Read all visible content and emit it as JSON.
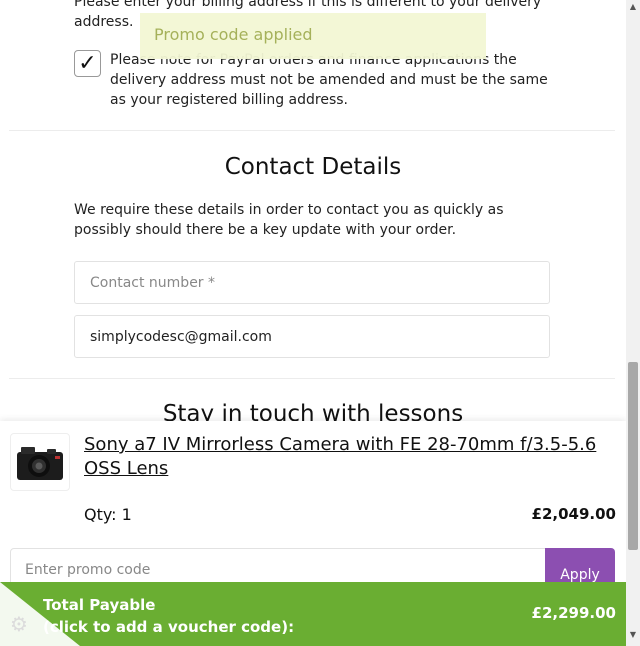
{
  "billing": {
    "note": "Please enter your billing address if this is different to your delivery address.",
    "checkbox_checked": true,
    "checkbox_mark": "✓",
    "paypal_note": "Please note for PayPal orders and finance applications the delivery address must not be amended and must be the same as your registered billing address."
  },
  "toast": {
    "message": "Promo code applied"
  },
  "contact": {
    "title": "Contact Details",
    "description": "We require these details in order to contact you as quickly as possibly should there be a key update with your order.",
    "phone_placeholder": "Contact number *",
    "phone_value": "",
    "email_value": "simplycodesc@gmail.com"
  },
  "next_section": {
    "title": "Stay in touch with lessons"
  },
  "summary": {
    "product_name": "Sony a7 IV Mirrorless Camera with FE 28-70mm f/3.5-5.6 OSS Lens",
    "qty": "Qty: 1",
    "price": "£2,049.00",
    "promo_placeholder": "Enter promo code",
    "apply_label": "Apply",
    "total_label": "Total Payable",
    "total_sub": "(click to add a voucher code):",
    "total_amount": "£2,299.00"
  },
  "icons": {
    "gear": "⚙",
    "scroll_up": "▲",
    "scroll_down": "▼"
  },
  "colors": {
    "total_bar": "#6aae32",
    "apply_button": "#8c4fb1",
    "toast_bg": "#f2f7d4",
    "toast_text": "#a5b15a"
  }
}
